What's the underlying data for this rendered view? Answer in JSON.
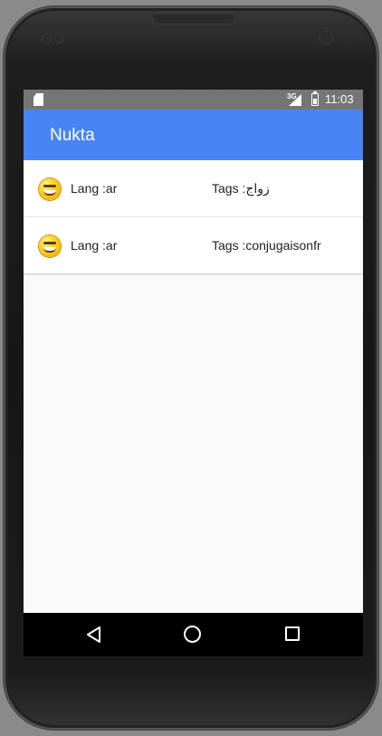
{
  "status_bar": {
    "network_label": "3G",
    "time": "11:03"
  },
  "app_bar": {
    "title": "Nukta"
  },
  "list": {
    "items": [
      {
        "lang": "Lang :ar",
        "tags": "Tags :زواج",
        "icon": "smiley-icon"
      },
      {
        "lang": "Lang :ar",
        "tags": "Tags :conjugaisonfr",
        "icon": "smiley-icon"
      }
    ]
  },
  "nav_bar": {
    "icons": [
      "back-icon",
      "home-icon",
      "recent-apps-icon"
    ]
  },
  "colors": {
    "app_bar": "#4785f4",
    "status_bar": "#757575",
    "nav_bar": "#000000",
    "screen_background": "#fafafa"
  }
}
